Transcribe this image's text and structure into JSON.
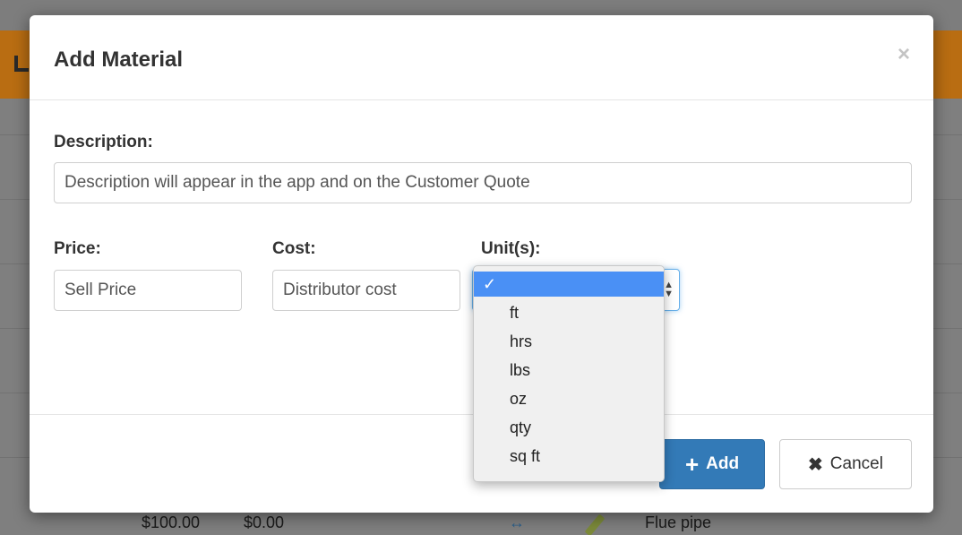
{
  "background": {
    "row": {
      "price": "$100.00",
      "cost": "$0.00",
      "description": "Flue pipe"
    }
  },
  "modal": {
    "title": "Add Material",
    "close_glyph": "×",
    "description_label": "Description:",
    "description_placeholder": "Description will appear in the app and on the Customer Quote",
    "price_label": "Price:",
    "price_placeholder": "Sell Price",
    "cost_label": "Cost:",
    "cost_placeholder": "Distributor cost",
    "units_label": "Unit(s):",
    "units_selected": "",
    "units_options": [
      "",
      "ft",
      "hrs",
      "lbs",
      "oz",
      "qty",
      "sq ft"
    ],
    "add_label": "Add",
    "cancel_label": "Cancel"
  },
  "colors": {
    "primary_button": "#337ab7",
    "dropdown_highlight": "#4a90f5",
    "header_bar": "#b96d12"
  },
  "icons": {
    "close": "close-icon",
    "add": "plus-icon",
    "cancel": "x-icon",
    "selected_check": "check-icon"
  }
}
